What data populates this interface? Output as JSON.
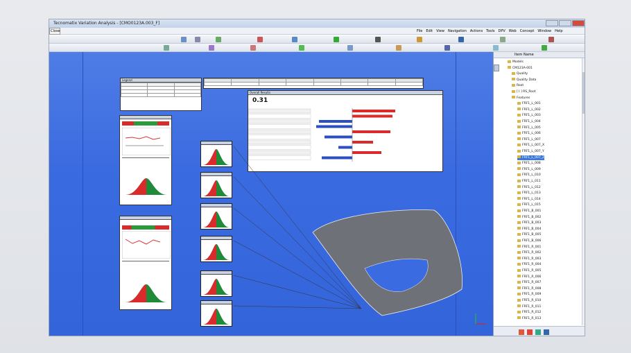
{
  "window": {
    "title": "Tecnomatix Variation Analysis - [CMO0123A.003_F]",
    "tab_label": "Close"
  },
  "menu": [
    "File",
    "Edit",
    "View",
    "Navigation",
    "Actions",
    "Tools",
    "DPV",
    "Web",
    "Concept",
    "Window",
    "Help"
  ],
  "tree": {
    "header": "Item Name",
    "items": [
      "Models",
      "CM123A-001",
      "Quality",
      "Quality Data",
      "Root",
      "[ I ] RS_Root",
      "Features",
      "FRF1_L_001",
      "FRF1_L_002",
      "FRF1_L_003",
      "FRF1_L_004",
      "FRF1_L_005",
      "FRF1_L_006",
      "FRF1_L_007",
      "FRF1_L_007_X",
      "FRF1_L_007_Y",
      "FRF1_L_007_Z",
      "FRF1_L_008",
      "FRF1_L_009",
      "FRF1_L_010",
      "FRF1_L_011",
      "FRF1_L_012",
      "FRF1_L_013",
      "FRF1_L_014",
      "FRF1_L_015",
      "FRF1_B_001",
      "FRF1_B_002",
      "FRF1_B_003",
      "FRF1_B_004",
      "FRF1_B_005",
      "FRF1_B_006",
      "FRF1_R_001",
      "FRF1_R_002",
      "FRF1_R_003",
      "FRF1_R_004",
      "FRF1_R_005",
      "FRF1_R_006",
      "FRF1_R_007",
      "FRF1_R_008",
      "FRF1_R_009",
      "FRF1_R_010",
      "FRF1_R_011",
      "FRF1_R_012",
      "FRF1_R_013"
    ]
  },
  "report": {
    "title": "Overall Results",
    "value": "0.31",
    "legend_title": "Legend"
  },
  "colors": {
    "viewport": "#3b6be0",
    "red": "#d92b2b",
    "green": "#1e8a3a",
    "blue": "#2b4fc2"
  }
}
